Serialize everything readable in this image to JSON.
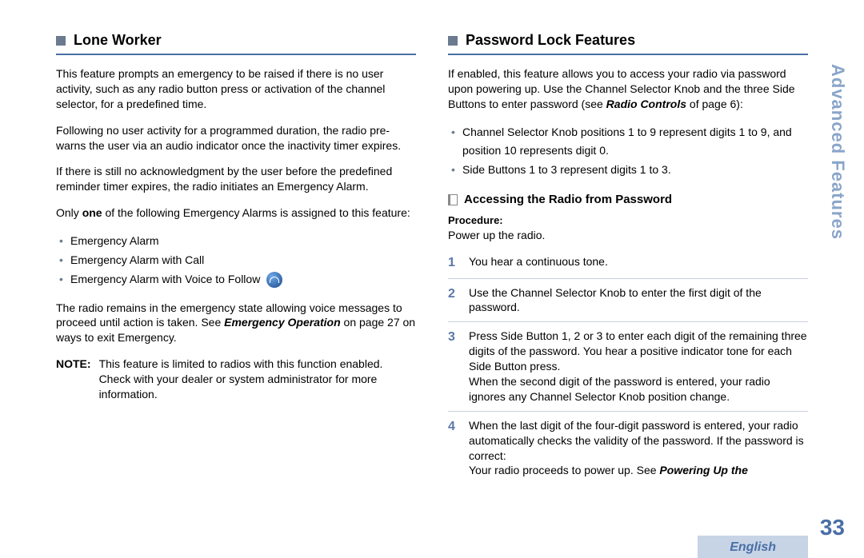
{
  "sideTab": "Advanced Features",
  "pageNumber": "33",
  "language": "English",
  "left": {
    "heading": "Lone Worker",
    "p1": "This feature prompts an emergency to be raised if there is no user activity, such as any radio button press or activation of the channel selector, for a predefined time.",
    "p2": "Following no user activity for a programmed duration, the radio pre-warns the user via an audio indicator once the inactivity timer expires.",
    "p3": "If there is still no acknowledgment by the user before the predefined reminder timer expires, the radio initiates an Emergency Alarm.",
    "p4_pre": "Only ",
    "p4_bold": "one",
    "p4_post": " of the following Emergency Alarms is assigned to this feature:",
    "bullets": [
      "Emergency Alarm",
      "Emergency Alarm with Call",
      "Emergency Alarm with Voice to Follow"
    ],
    "p5_pre": "The radio remains in the emergency state allowing voice messages to proceed until action is taken. See ",
    "p5_ref": "Emergency Operation",
    "p5_post": " on page 27 on ways to exit Emergency.",
    "noteLabel": "NOTE:",
    "noteText": "This feature is limited to radios with this function enabled. Check with your dealer or system administrator for more information."
  },
  "right": {
    "heading": "Password Lock Features",
    "p1_pre": "If enabled, this feature allows you to access your radio via password upon powering up. Use the Channel Selector Knob and the three Side Buttons to enter password (see ",
    "p1_ref": "Radio Controls",
    "p1_post": " of page 6):",
    "bullets": [
      "Channel Selector Knob positions 1 to 9 represent digits 1 to 9, and position 10 represents digit 0.",
      "Side Buttons 1 to 3 represent digits 1 to 3."
    ],
    "subheading": "Accessing the Radio from Password",
    "procLabel": "Procedure:",
    "procIntro": "Power up the radio.",
    "steps": [
      {
        "num": "1",
        "text": "You hear a continuous tone."
      },
      {
        "num": "2",
        "text": "Use the Channel Selector Knob to enter the first digit of the password."
      },
      {
        "num": "3",
        "text": "Press Side Button 1, 2 or 3 to enter each digit of the remaining three digits of the password. You hear a positive indicator tone for each Side Button press.\nWhen the second digit of the password is entered, your radio ignores any Channel Selector Knob position change."
      },
      {
        "num": "4",
        "text_pre": "When the last digit of the four-digit password is entered, your radio automatically checks the validity of the password. If the password is correct:\nYour radio proceeds to power up. See ",
        "text_ref": "Powering Up the"
      }
    ]
  }
}
